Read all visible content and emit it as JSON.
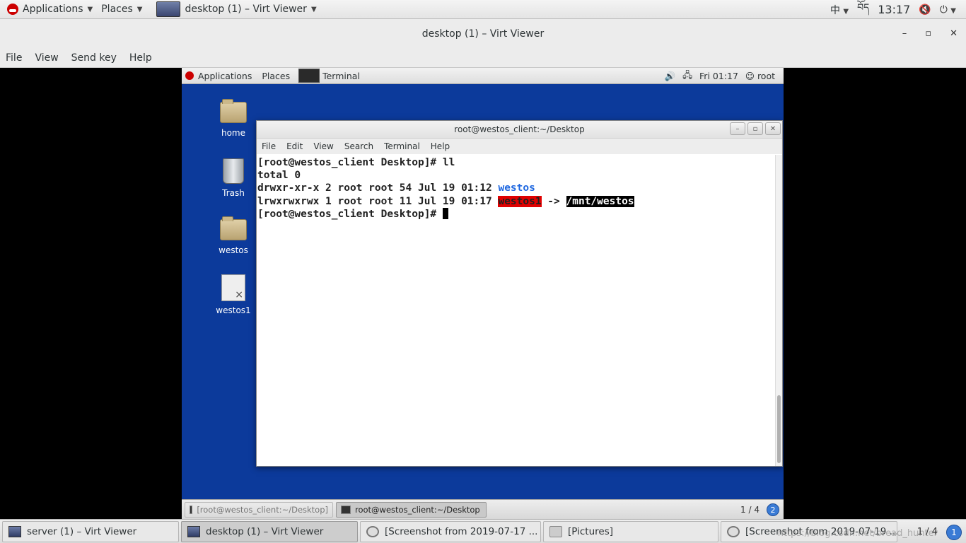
{
  "host_top": {
    "applications": "Applications",
    "places": "Places",
    "window_title": "desktop (1) – Virt Viewer",
    "input_method": "中",
    "keyboard_layout": "བོད",
    "clock": "13:17"
  },
  "viewer": {
    "title": "desktop (1) – Virt Viewer",
    "menu": [
      "File",
      "View",
      "Send key",
      "Help"
    ]
  },
  "guest_top": {
    "applications": "Applications",
    "places": "Places",
    "terminal": "Terminal",
    "clock": "Fri 01:17",
    "user": "root"
  },
  "desktop_icons": [
    {
      "label": "home",
      "icon": "folder-home-icon"
    },
    {
      "label": "Trash",
      "icon": "trash-icon"
    },
    {
      "label": "westos",
      "icon": "folder-icon"
    },
    {
      "label": "westos1",
      "icon": "broken-link-icon"
    }
  ],
  "terminal": {
    "title": "root@westos_client:~/Desktop",
    "menu": [
      "File",
      "Edit",
      "View",
      "Search",
      "Terminal",
      "Help"
    ],
    "lines": {
      "l1": "[root@westos_client Desktop]# ll",
      "l2": "total 0",
      "l3_prefix": "drwxr-xr-x 2 root root 54 Jul 19 01:12 ",
      "l3_name": "westos",
      "l4_prefix": "lrwxrwxrwx 1 root root 11 Jul 19 01:17 ",
      "l4_name": "westos1",
      "l4_arrow": " -> ",
      "l4_target": "/mnt/westos",
      "l5": "[root@westos_client Desktop]# "
    }
  },
  "guest_bottom": {
    "tasks": [
      "[root@westos_client:~/Desktop]",
      "root@westos_client:~/Desktop"
    ],
    "pager": "1 / 4",
    "notifications": "2"
  },
  "host_bottom": {
    "tasks": [
      "server (1) – Virt Viewer",
      "desktop (1) – Virt Viewer",
      "[Screenshot from 2019-07-17 ...",
      "[Pictures]",
      "[Screenshot from 2019-07-19 ..."
    ],
    "pager": "1 / 4",
    "notifications": "1",
    "watermark": "https://blog.csdn.net/bread_hunter"
  }
}
